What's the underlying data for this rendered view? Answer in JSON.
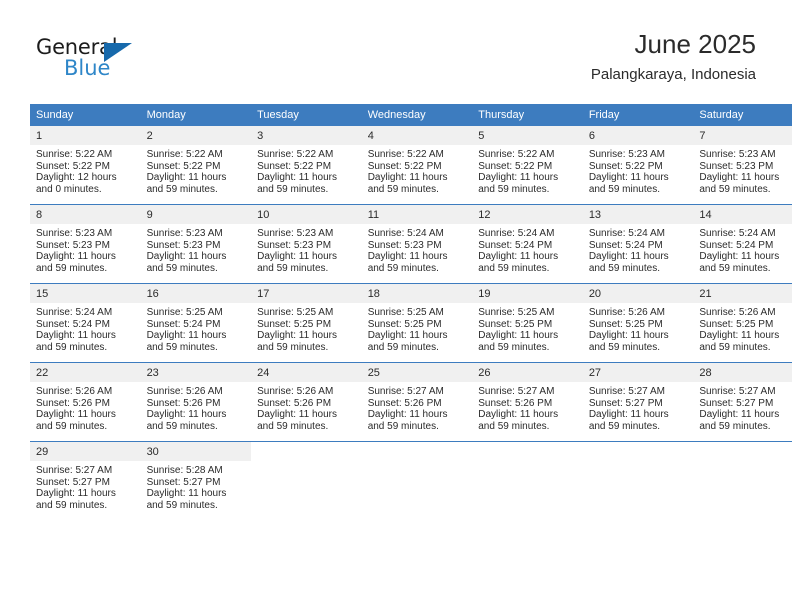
{
  "logo": {
    "word_top": "General",
    "word_bottom": "Blue",
    "triangle_color": "#1769ab",
    "blue_color": "#2e86c8"
  },
  "header": {
    "title": "June 2025",
    "subtitle": "Palangkaraya, Indonesia"
  },
  "theme": {
    "header_bg": "#3d7cbf",
    "daynum_bg": "#f0f0f0",
    "grid_line": "#3d7cbf"
  },
  "weekday_headers": [
    "Sunday",
    "Monday",
    "Tuesday",
    "Wednesday",
    "Thursday",
    "Friday",
    "Saturday"
  ],
  "weeks": [
    [
      {
        "day": "1",
        "sunrise": "Sunrise: 5:22 AM",
        "sunset": "Sunset: 5:22 PM",
        "daylight1": "Daylight: 12 hours",
        "daylight2": "and 0 minutes."
      },
      {
        "day": "2",
        "sunrise": "Sunrise: 5:22 AM",
        "sunset": "Sunset: 5:22 PM",
        "daylight1": "Daylight: 11 hours",
        "daylight2": "and 59 minutes."
      },
      {
        "day": "3",
        "sunrise": "Sunrise: 5:22 AM",
        "sunset": "Sunset: 5:22 PM",
        "daylight1": "Daylight: 11 hours",
        "daylight2": "and 59 minutes."
      },
      {
        "day": "4",
        "sunrise": "Sunrise: 5:22 AM",
        "sunset": "Sunset: 5:22 PM",
        "daylight1": "Daylight: 11 hours",
        "daylight2": "and 59 minutes."
      },
      {
        "day": "5",
        "sunrise": "Sunrise: 5:22 AM",
        "sunset": "Sunset: 5:22 PM",
        "daylight1": "Daylight: 11 hours",
        "daylight2": "and 59 minutes."
      },
      {
        "day": "6",
        "sunrise": "Sunrise: 5:23 AM",
        "sunset": "Sunset: 5:22 PM",
        "daylight1": "Daylight: 11 hours",
        "daylight2": "and 59 minutes."
      },
      {
        "day": "7",
        "sunrise": "Sunrise: 5:23 AM",
        "sunset": "Sunset: 5:23 PM",
        "daylight1": "Daylight: 11 hours",
        "daylight2": "and 59 minutes."
      }
    ],
    [
      {
        "day": "8",
        "sunrise": "Sunrise: 5:23 AM",
        "sunset": "Sunset: 5:23 PM",
        "daylight1": "Daylight: 11 hours",
        "daylight2": "and 59 minutes."
      },
      {
        "day": "9",
        "sunrise": "Sunrise: 5:23 AM",
        "sunset": "Sunset: 5:23 PM",
        "daylight1": "Daylight: 11 hours",
        "daylight2": "and 59 minutes."
      },
      {
        "day": "10",
        "sunrise": "Sunrise: 5:23 AM",
        "sunset": "Sunset: 5:23 PM",
        "daylight1": "Daylight: 11 hours",
        "daylight2": "and 59 minutes."
      },
      {
        "day": "11",
        "sunrise": "Sunrise: 5:24 AM",
        "sunset": "Sunset: 5:23 PM",
        "daylight1": "Daylight: 11 hours",
        "daylight2": "and 59 minutes."
      },
      {
        "day": "12",
        "sunrise": "Sunrise: 5:24 AM",
        "sunset": "Sunset: 5:24 PM",
        "daylight1": "Daylight: 11 hours",
        "daylight2": "and 59 minutes."
      },
      {
        "day": "13",
        "sunrise": "Sunrise: 5:24 AM",
        "sunset": "Sunset: 5:24 PM",
        "daylight1": "Daylight: 11 hours",
        "daylight2": "and 59 minutes."
      },
      {
        "day": "14",
        "sunrise": "Sunrise: 5:24 AM",
        "sunset": "Sunset: 5:24 PM",
        "daylight1": "Daylight: 11 hours",
        "daylight2": "and 59 minutes."
      }
    ],
    [
      {
        "day": "15",
        "sunrise": "Sunrise: 5:24 AM",
        "sunset": "Sunset: 5:24 PM",
        "daylight1": "Daylight: 11 hours",
        "daylight2": "and 59 minutes."
      },
      {
        "day": "16",
        "sunrise": "Sunrise: 5:25 AM",
        "sunset": "Sunset: 5:24 PM",
        "daylight1": "Daylight: 11 hours",
        "daylight2": "and 59 minutes."
      },
      {
        "day": "17",
        "sunrise": "Sunrise: 5:25 AM",
        "sunset": "Sunset: 5:25 PM",
        "daylight1": "Daylight: 11 hours",
        "daylight2": "and 59 minutes."
      },
      {
        "day": "18",
        "sunrise": "Sunrise: 5:25 AM",
        "sunset": "Sunset: 5:25 PM",
        "daylight1": "Daylight: 11 hours",
        "daylight2": "and 59 minutes."
      },
      {
        "day": "19",
        "sunrise": "Sunrise: 5:25 AM",
        "sunset": "Sunset: 5:25 PM",
        "daylight1": "Daylight: 11 hours",
        "daylight2": "and 59 minutes."
      },
      {
        "day": "20",
        "sunrise": "Sunrise: 5:26 AM",
        "sunset": "Sunset: 5:25 PM",
        "daylight1": "Daylight: 11 hours",
        "daylight2": "and 59 minutes."
      },
      {
        "day": "21",
        "sunrise": "Sunrise: 5:26 AM",
        "sunset": "Sunset: 5:25 PM",
        "daylight1": "Daylight: 11 hours",
        "daylight2": "and 59 minutes."
      }
    ],
    [
      {
        "day": "22",
        "sunrise": "Sunrise: 5:26 AM",
        "sunset": "Sunset: 5:26 PM",
        "daylight1": "Daylight: 11 hours",
        "daylight2": "and 59 minutes."
      },
      {
        "day": "23",
        "sunrise": "Sunrise: 5:26 AM",
        "sunset": "Sunset: 5:26 PM",
        "daylight1": "Daylight: 11 hours",
        "daylight2": "and 59 minutes."
      },
      {
        "day": "24",
        "sunrise": "Sunrise: 5:26 AM",
        "sunset": "Sunset: 5:26 PM",
        "daylight1": "Daylight: 11 hours",
        "daylight2": "and 59 minutes."
      },
      {
        "day": "25",
        "sunrise": "Sunrise: 5:27 AM",
        "sunset": "Sunset: 5:26 PM",
        "daylight1": "Daylight: 11 hours",
        "daylight2": "and 59 minutes."
      },
      {
        "day": "26",
        "sunrise": "Sunrise: 5:27 AM",
        "sunset": "Sunset: 5:26 PM",
        "daylight1": "Daylight: 11 hours",
        "daylight2": "and 59 minutes."
      },
      {
        "day": "27",
        "sunrise": "Sunrise: 5:27 AM",
        "sunset": "Sunset: 5:27 PM",
        "daylight1": "Daylight: 11 hours",
        "daylight2": "and 59 minutes."
      },
      {
        "day": "28",
        "sunrise": "Sunrise: 5:27 AM",
        "sunset": "Sunset: 5:27 PM",
        "daylight1": "Daylight: 11 hours",
        "daylight2": "and 59 minutes."
      }
    ],
    [
      {
        "day": "29",
        "sunrise": "Sunrise: 5:27 AM",
        "sunset": "Sunset: 5:27 PM",
        "daylight1": "Daylight: 11 hours",
        "daylight2": "and 59 minutes."
      },
      {
        "day": "30",
        "sunrise": "Sunrise: 5:28 AM",
        "sunset": "Sunset: 5:27 PM",
        "daylight1": "Daylight: 11 hours",
        "daylight2": "and 59 minutes."
      },
      {
        "day": "",
        "sunrise": "",
        "sunset": "",
        "daylight1": "",
        "daylight2": ""
      },
      {
        "day": "",
        "sunrise": "",
        "sunset": "",
        "daylight1": "",
        "daylight2": ""
      },
      {
        "day": "",
        "sunrise": "",
        "sunset": "",
        "daylight1": "",
        "daylight2": ""
      },
      {
        "day": "",
        "sunrise": "",
        "sunset": "",
        "daylight1": "",
        "daylight2": ""
      },
      {
        "day": "",
        "sunrise": "",
        "sunset": "",
        "daylight1": "",
        "daylight2": ""
      }
    ]
  ]
}
